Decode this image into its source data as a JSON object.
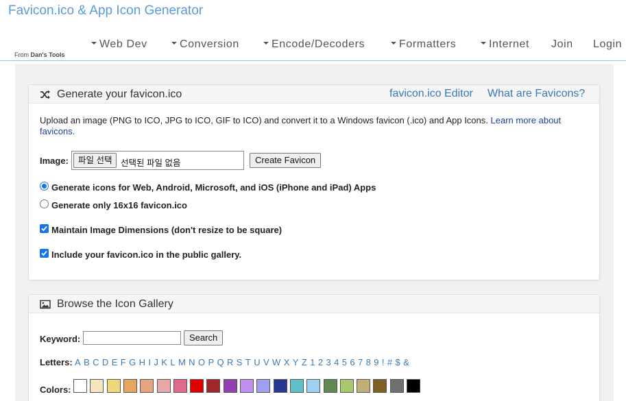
{
  "site": {
    "title": "Favicon.ico & App Icon Generator",
    "from_prefix": "From",
    "from_name": "Dan's Tools"
  },
  "nav": [
    {
      "label": "Web Dev",
      "dropdown": true
    },
    {
      "label": "Conversion",
      "dropdown": true
    },
    {
      "label": "Encode/Decoders",
      "dropdown": true
    },
    {
      "label": "Formatters",
      "dropdown": true
    },
    {
      "label": "Internet",
      "dropdown": true
    },
    {
      "label": "Join",
      "dropdown": false
    },
    {
      "label": "Login",
      "dropdown": false
    }
  ],
  "generate": {
    "title": "Generate your favicon.ico",
    "icon": "shuffle-icon",
    "links": {
      "editor": "favicon.ico Editor",
      "what": "What are Favicons?"
    },
    "intro": "Upload an image (PNG to ICO, JPG to ICO, GIF to ICO) and convert it to a Windows favicon (.ico) and App Icons.",
    "intro_link": "Learn more about favicons.",
    "image_label": "Image:",
    "file_button": "파일 선택",
    "file_status": "선택된 파일 없음",
    "create_button": "Create Favicon",
    "options": {
      "all_icons": "Generate icons for Web, Android, Microsoft, and iOS (iPhone and iPad) Apps",
      "only_16": "Generate only 16x16 favicon.ico",
      "maintain": "Maintain Image Dimensions (don't resize to be square)",
      "gallery": "Include your favicon.ico in the public gallery."
    },
    "selected_option": "all_icons",
    "maintain_checked": true,
    "gallery_checked": true
  },
  "gallery": {
    "title": "Browse the Icon Gallery",
    "icon": "image-icon",
    "keyword_label": "Keyword:",
    "keyword_value": "",
    "search_button": "Search",
    "letters_label": "Letters:",
    "letters": [
      "A",
      "B",
      "C",
      "D",
      "E",
      "F",
      "G",
      "H",
      "I",
      "J",
      "K",
      "L",
      "M",
      "N",
      "O",
      "P",
      "Q",
      "R",
      "S",
      "T",
      "U",
      "V",
      "W",
      "X",
      "Y",
      "Z",
      "1",
      "2",
      "3",
      "4",
      "5",
      "6",
      "7",
      "8",
      "9",
      "!",
      "#",
      "$",
      "&"
    ],
    "colors_label": "Colors:",
    "colors": [
      "#ffffff",
      "#f5e6c0",
      "#f0d77a",
      "#e8a55e",
      "#e8a381",
      "#e8a8a8",
      "#e06a8c",
      "#e00000",
      "#a02828",
      "#9040b0",
      "#c090f0",
      "#a0a0f0",
      "#283890",
      "#60c0c8",
      "#a0d0f0",
      "#608850",
      "#a8c870",
      "#c0b078",
      "#806020",
      "#707070",
      "#000000"
    ]
  }
}
